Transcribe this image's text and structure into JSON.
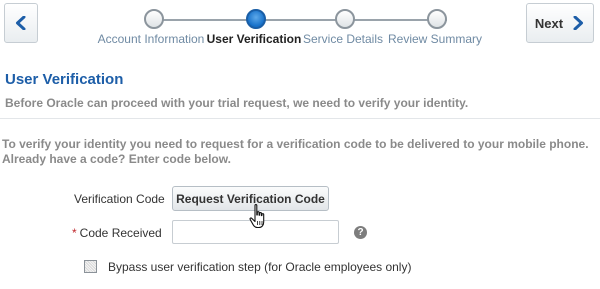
{
  "train": {
    "prev_icon": "chevron-left-icon",
    "next_label": "Next",
    "next_icon": "chevron-right-icon",
    "stops": [
      {
        "label": "Account Information",
        "state": "visited"
      },
      {
        "label": "User Verification",
        "state": "current"
      },
      {
        "label": "Service Details",
        "state": "unvisited"
      },
      {
        "label": "Review Summary",
        "state": "unvisited"
      }
    ]
  },
  "section": {
    "title": "User Verification",
    "subtitle": "Before Oracle can proceed with your trial request, we need to verify your identity."
  },
  "instructions": {
    "line1": "To verify your identity you need to request for a verification code to be delivered to your mobile phone.",
    "line2": "Already have a code? Enter code below."
  },
  "form": {
    "verification_code_label": "Verification Code",
    "request_button_label": "Request Verification Code",
    "required_marker": "*",
    "code_received_label": "Code Received",
    "code_received_value": "",
    "help_icon": "help-icon",
    "help_glyph": "?",
    "bypass_label": "Bypass user verification step (for Oracle employees only)",
    "bypass_checked": false
  },
  "colors": {
    "accent": "#1d5ea8",
    "current_stop": "#1670c9",
    "required": "#c0282d",
    "muted_text": "#8a8a8a"
  },
  "cursor_icon": "hand-pointer-icon"
}
